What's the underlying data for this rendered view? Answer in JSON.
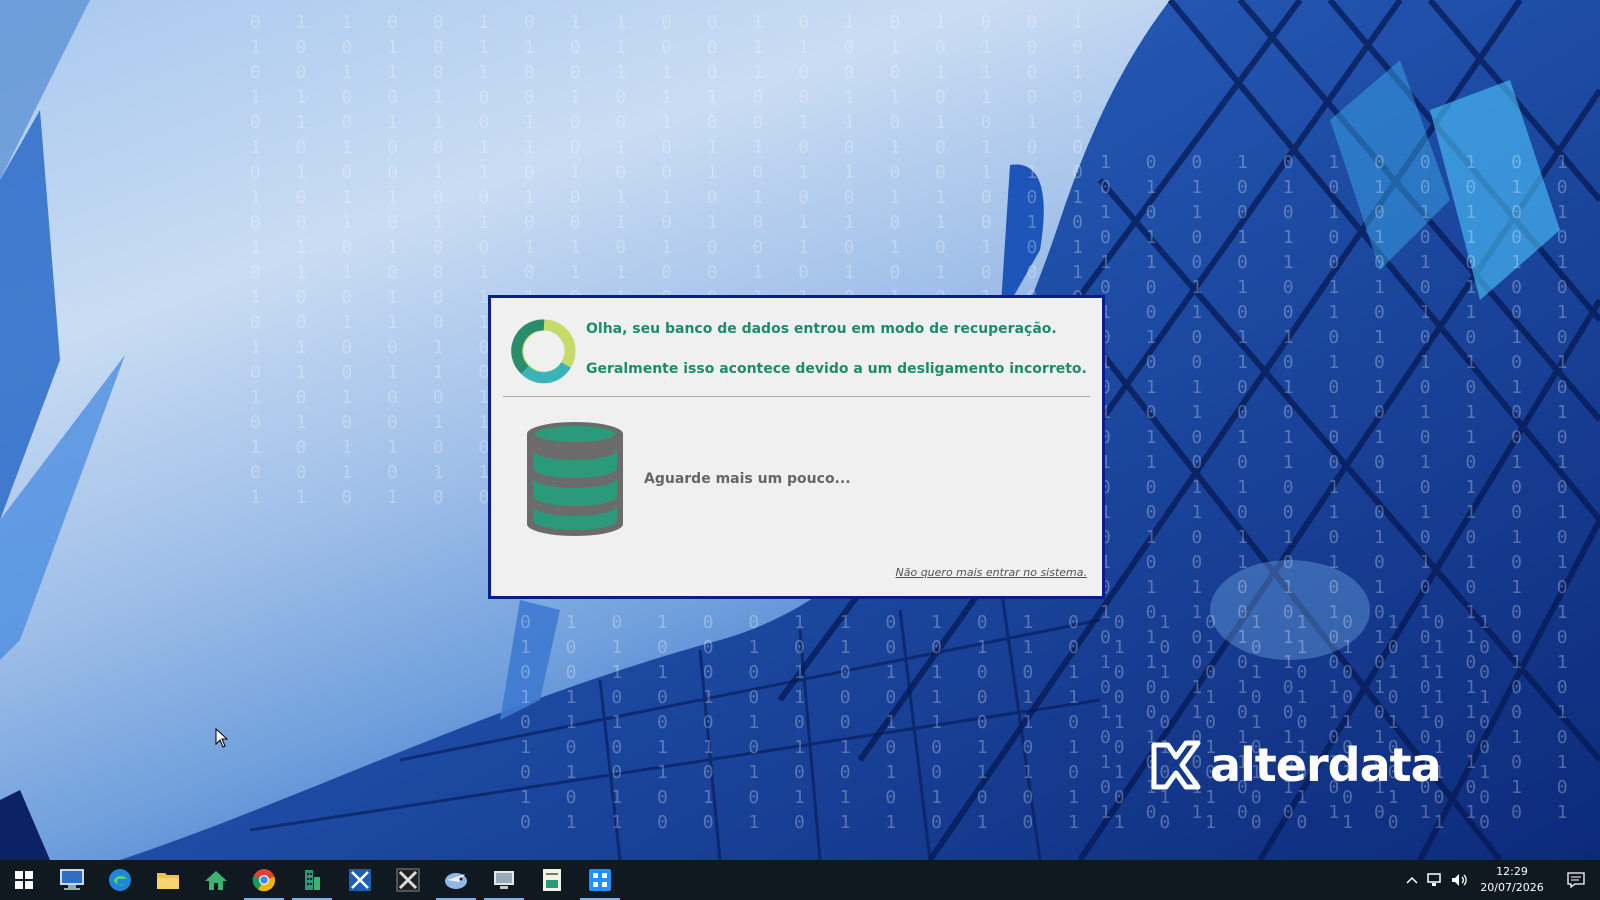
{
  "dialog": {
    "message_line1": "Olha, seu banco de dados entrou em modo de recuperação.",
    "message_line2": "Geralmente isso acontece devido a um desligamento incorreto.",
    "wait_text": "Aguarde mais um pouco...",
    "exit_link": "Não quero mais entrar no sistema."
  },
  "brand": {
    "name": "alterdata"
  },
  "taskbar": {
    "apps": [
      "start-icon",
      "computer-icon",
      "edge-icon",
      "file-explorer-icon",
      "home-icon",
      "chrome-icon",
      "building-app-icon",
      "alterdata-app-icon",
      "x-app-icon",
      "bird-app-icon",
      "monitor-app-icon",
      "document-app-icon",
      "puzzle-app-icon"
    ],
    "time": "12:29",
    "date": "20/07/2026"
  },
  "colors": {
    "accent_green": "#1d8c6b",
    "dialog_border": "#0a1d8f",
    "taskbar": "#101820"
  }
}
